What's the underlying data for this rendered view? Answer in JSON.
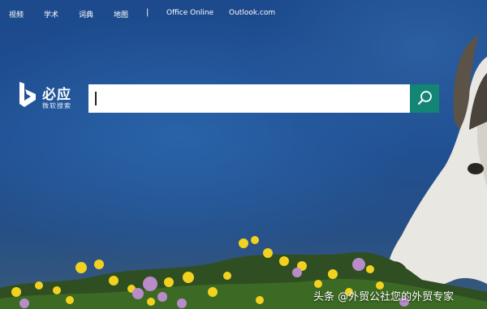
{
  "nav": {
    "items": [
      "视频",
      "学术",
      "词典",
      "地图"
    ],
    "separator": "|",
    "links": [
      "Office Online",
      "Outlook.com"
    ]
  },
  "logo": {
    "name": "必应",
    "subtitle": "微软搜索"
  },
  "search": {
    "value": "",
    "placeholder": "",
    "button_icon": "search-icon"
  },
  "watermark": {
    "text": "头条 @外贸公社您的外贸专家"
  },
  "colors": {
    "sky": "#1f4f92",
    "search_button": "#138574",
    "text": "#ffffff"
  }
}
